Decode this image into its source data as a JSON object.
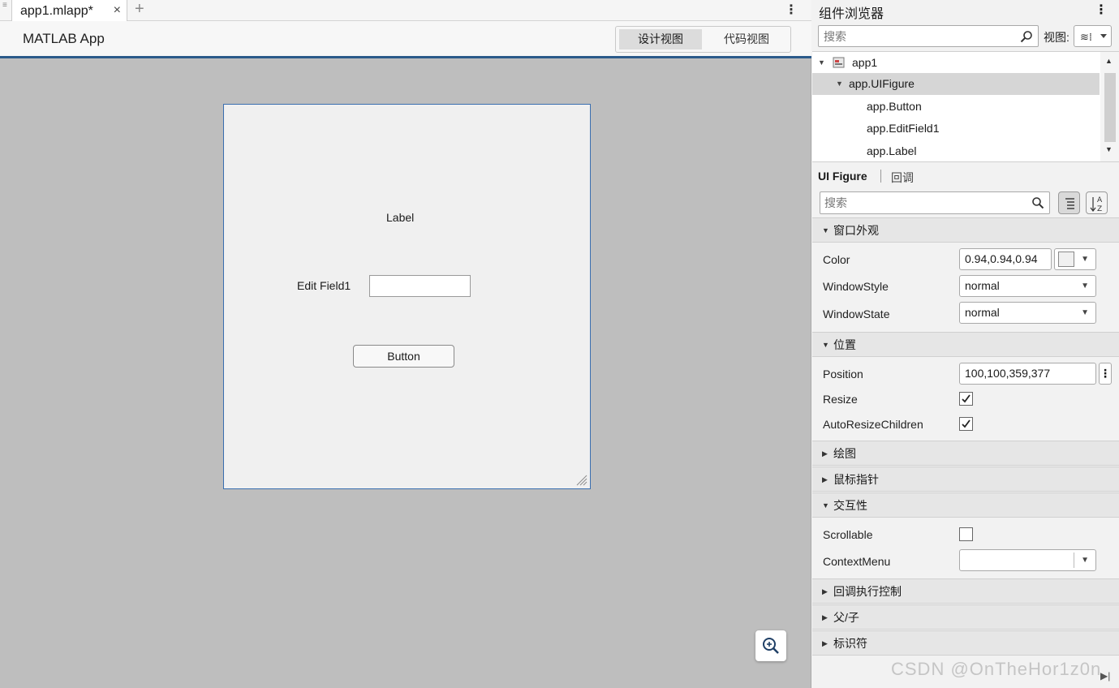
{
  "tabbar": {
    "file_tab": "app1.mlapp*",
    "close": "×",
    "add": "+"
  },
  "header": {
    "app_title": "MATLAB App",
    "design_view": "设计视图",
    "code_view": "代码视图"
  },
  "canvas": {
    "label_text": "Label",
    "edit_field_label": "Edit Field1",
    "button_text": "Button"
  },
  "component_browser": {
    "title": "组件浏览器",
    "search_placeholder": "搜索",
    "view_label": "视图:",
    "tree": [
      {
        "label": "app1"
      },
      {
        "label": "app.UIFigure"
      },
      {
        "label": "app.Button"
      },
      {
        "label": "app.EditField1"
      },
      {
        "label": "app.Label"
      }
    ]
  },
  "inspector": {
    "tab_uifigure": "UI Figure",
    "tab_callback": "回调",
    "search_placeholder": "搜索",
    "sections": {
      "appearance": "窗口外观",
      "position": "位置",
      "plotting": "绘图",
      "pointer": "鼠标指针",
      "interactivity": "交互性",
      "callback_exec": "回调执行控制",
      "parent_child": "父/子",
      "identifiers": "标识符"
    },
    "props": {
      "color_label": "Color",
      "color_value": "0.94,0.94,0.94",
      "windowstyle_label": "WindowStyle",
      "windowstyle_value": "normal",
      "windowstate_label": "WindowState",
      "windowstate_value": "normal",
      "position_label": "Position",
      "position_value": "100,100,359,377",
      "resize_label": "Resize",
      "autoresize_label": "AutoResizeChildren",
      "scrollable_label": "Scrollable",
      "contextmenu_label": "ContextMenu",
      "contextmenu_value": ""
    },
    "checks": {
      "resize": true,
      "autoresize": true,
      "scrollable": false
    }
  },
  "watermark": "CSDN @OnTheHor1z0n",
  "colors": {
    "accent": "#2b5a8a",
    "canvas_bg": "#bebebe",
    "figure_bg": "#f0f0f0",
    "selected_row": "#d6d6d6"
  }
}
